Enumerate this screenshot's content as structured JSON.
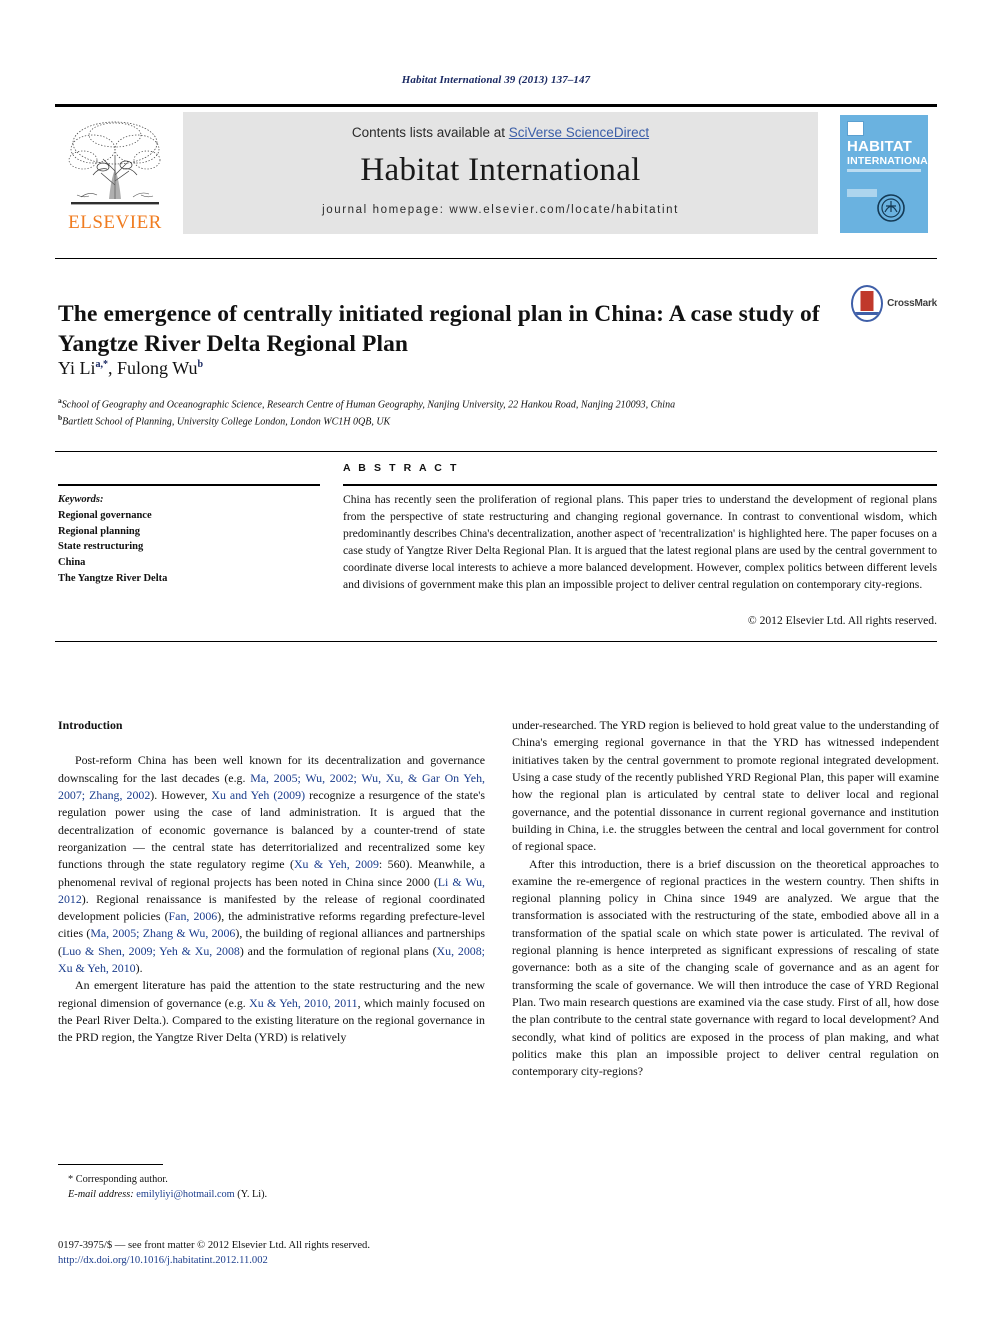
{
  "running_head": "Habitat International 39 (2013) 137–147",
  "banner": {
    "publisher": "ELSEVIER",
    "contents_prefix": "Contents lists available at ",
    "contents_link": "SciVerse ScienceDirect",
    "journal_title": "Habitat International",
    "homepage": "journal homepage: www.elsevier.com/locate/habitatint",
    "cover": {
      "line1": "HABITAT",
      "line2": "INTERNATIONAL"
    }
  },
  "article": {
    "title": "The emergence of centrally initiated regional plan in China: A case study of Yangtze River Delta Regional Plan",
    "crossmark_label": "CrossMark",
    "authors_prefix": "Yi Li",
    "author1_sup": "a,*",
    "authors_mid": ", Fulong Wu",
    "author2_sup": "b",
    "affiliation_a_sup": "a",
    "affiliation_a": "School of Geography and Oceanographic Science, Research Centre of Human Geography, Nanjing University, 22 Hankou Road, Nanjing 210093, China",
    "affiliation_b_sup": "b",
    "affiliation_b": "Bartlett School of Planning, University College London, London WC1H 0QB, UK"
  },
  "keywords": {
    "label": "Keywords:",
    "items": [
      "Regional governance",
      "Regional planning",
      "State restructuring",
      "China",
      "The Yangtze River Delta"
    ]
  },
  "abstract": {
    "heading": "A B S T R A C T",
    "text": "China has recently seen the proliferation of regional plans. This paper tries to understand the development of regional plans from the perspective of state restructuring and changing regional governance. In contrast to conventional wisdom, which predominantly describes China's decentralization, another aspect of 'recentralization' is highlighted here. The paper focuses on a case study of Yangtze River Delta Regional Plan. It is argued that the latest regional plans are used by the central government to coordinate diverse local interests to achieve a more balanced development. However, complex politics between different levels and divisions of government make this plan an impossible project to deliver central regulation on contemporary city-regions.",
    "copyright": "© 2012 Elsevier Ltd. All rights reserved."
  },
  "body": {
    "section_heading": "Introduction",
    "left_p1_a": "Post-reform China has been well known for its decentralization and governance downscaling for the last decades (e.g. ",
    "left_p1_c1": "Ma, 2005; Wu, 2002; Wu, Xu, & Gar On Yeh, 2007; Zhang, 2002",
    "left_p1_b": "). However, ",
    "left_p1_c2": "Xu and Yeh (2009)",
    "left_p1_c": " recognize a resurgence of the state's regulation power using the case of land administration. It is argued that the decentralization of economic governance is balanced by a counter-trend of state reorganization — the central state has deterritorialized and recentralized some key functions through the state regulatory regime (",
    "left_p1_c3": "Xu & Yeh, 2009",
    "left_p1_d": ": 560). Meanwhile, a phenomenal revival of regional projects has been noted in China since 2000 (",
    "left_p1_c4": "Li & Wu, 2012",
    "left_p1_e": "). Regional renaissance is manifested by the release of regional coordinated development policies (",
    "left_p1_c5": "Fan, 2006",
    "left_p1_f": "), the administrative reforms regarding prefecture-level cities (",
    "left_p1_c6": "Ma, 2005; Zhang & Wu, 2006",
    "left_p1_g": "), the building of regional alliances and partnerships (",
    "left_p1_c7": "Luo & Shen, 2009; Yeh & Xu, 2008",
    "left_p1_h": ") and the formulation of regional plans (",
    "left_p1_c8": "Xu, 2008; Xu & Yeh, 2010",
    "left_p1_i": ").",
    "left_p2_a": "An emergent literature has paid the attention to the state restructuring and the new regional dimension of governance (e.g. ",
    "left_p2_c1": "Xu & Yeh, 2010, 2011",
    "left_p2_b": ", which mainly focused on the Pearl River Delta.). Compared to the existing literature on the regional governance in the PRD region, the Yangtze River Delta (YRD) is relatively",
    "right_p1": "under-researched. The YRD region is believed to hold great value to the understanding of China's emerging regional governance in that the YRD has witnessed independent initiatives taken by the central government to promote regional integrated development. Using a case study of the recently published YRD Regional Plan, this paper will examine how the regional plan is articulated by central state to deliver local and regional governance, and the potential dissonance in current regional governance and institution building in China, i.e. the struggles between the central and local government for control of regional space.",
    "right_p2": "After this introduction, there is a brief discussion on the theoretical approaches to examine the re-emergence of regional practices in the western country. Then shifts in regional planning policy in China since 1949 are analyzed. We argue that the transformation is associated with the restructuring of the state, embodied above all in a transformation of the spatial scale on which state power is articulated. The revival of regional planning is hence interpreted as significant expressions of rescaling of state governance: both as a site of the changing scale of governance and as an agent for transforming the scale of governance. We will then introduce the case of YRD Regional Plan. Two main research questions are examined via the case study. First of all, how dose the plan contribute to the central state governance with regard to local development? And secondly, what kind of politics are exposed in the process of plan making, and what politics make this plan an impossible project to deliver central regulation on contemporary city-regions?"
  },
  "footnote": {
    "corresponding": "* Corresponding author.",
    "email_label": "E-mail address:",
    "email": "emilyliyi@hotmail.com",
    "email_suffix": "(Y. Li)."
  },
  "footer": {
    "issn_line": "0197-3975/$ — see front matter © 2012 Elsevier Ltd. All rights reserved.",
    "doi": "http://dx.doi.org/10.1016/j.habitatint.2012.11.002"
  },
  "colors": {
    "link": "#1a3c8c",
    "elsevier_orange": "#f07c20",
    "cover_blue": "#6ab2e0",
    "banner_gray": "#e4e4e4"
  }
}
